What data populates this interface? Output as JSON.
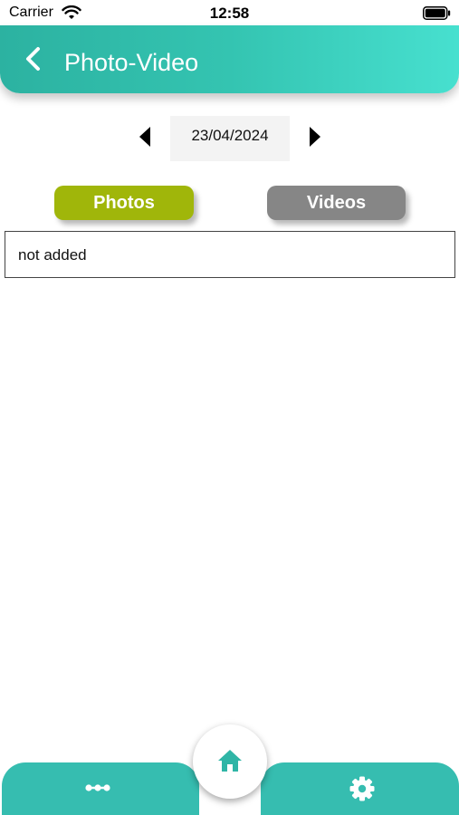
{
  "status_bar": {
    "carrier": "Carrier",
    "time": "12:58"
  },
  "header": {
    "title": "Photo-Video",
    "back_icon": "chevron-left-icon",
    "gradient": [
      "#2cb2a1",
      "#47e0cf"
    ]
  },
  "date_nav": {
    "date": "23/04/2024",
    "prev_icon": "triangle-left-icon",
    "next_icon": "triangle-right-icon"
  },
  "tabs": [
    {
      "label": "Photos",
      "active": true,
      "color": "#a0b60a"
    },
    {
      "label": "Videos",
      "active": false,
      "color": "#868686"
    }
  ],
  "content": {
    "empty_text": "not added"
  },
  "bottom_nav": {
    "color": "#36bdb0",
    "items": [
      {
        "icon": "dots-icon"
      },
      {
        "icon": "home-icon"
      },
      {
        "icon": "gear-icon"
      }
    ]
  }
}
